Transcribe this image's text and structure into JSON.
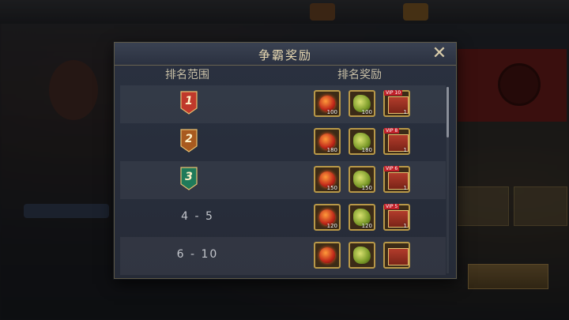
{
  "dialog": {
    "title": "争霸奖励",
    "header_rank": "排名范围",
    "header_reward": "排名奖励"
  },
  "rows": [
    {
      "rank": "1",
      "badge_color": "#c0392b",
      "rewards": [
        {
          "icon": "fire-orb-icon",
          "qty": "100"
        },
        {
          "icon": "jade-dragon-icon",
          "qty": "100"
        },
        {
          "icon": "vip-gift-box-icon",
          "badge": "VIP 10",
          "qty": "1"
        }
      ]
    },
    {
      "rank": "2",
      "badge_color": "#a85a1f",
      "rewards": [
        {
          "icon": "fire-orb-icon",
          "qty": "180"
        },
        {
          "icon": "jade-dragon-icon",
          "qty": "180"
        },
        {
          "icon": "vip-gift-box-icon",
          "badge": "VIP 8",
          "qty": "1"
        }
      ]
    },
    {
      "rank": "3",
      "badge_color": "#1f7a5a",
      "rewards": [
        {
          "icon": "fire-orb-icon",
          "qty": "150"
        },
        {
          "icon": "jade-dragon-icon",
          "qty": "150"
        },
        {
          "icon": "vip-gift-box-icon",
          "badge": "VIP 6",
          "qty": "1"
        }
      ]
    },
    {
      "rank": "4 - 5",
      "rewards": [
        {
          "icon": "fire-orb-icon",
          "qty": "120"
        },
        {
          "icon": "jade-dragon-icon",
          "qty": "120"
        },
        {
          "icon": "vip-gift-box-icon",
          "badge": "VIP 5",
          "qty": "1"
        }
      ]
    },
    {
      "rank": "6 - 10",
      "rewards": [
        {
          "icon": "fire-orb-icon",
          "qty": ""
        },
        {
          "icon": "jade-dragon-icon",
          "qty": ""
        },
        {
          "icon": "vip-gift-box-icon",
          "badge": "",
          "qty": ""
        }
      ]
    }
  ]
}
